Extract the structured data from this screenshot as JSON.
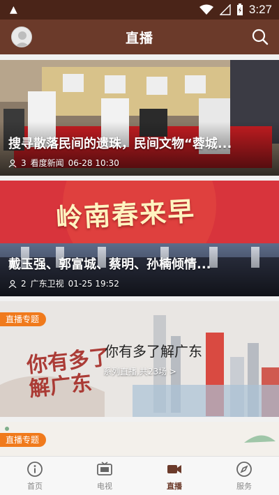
{
  "status_bar": {
    "time": "3:27"
  },
  "header": {
    "title": "直播"
  },
  "cards": [
    {
      "title": "搜寻散落民间的遗珠，民间文物“蓉城...",
      "viewers": "3",
      "source": "看度新闻",
      "datetime": "06-28 10:30"
    },
    {
      "title": "戴玉强、郭富城、蔡明、孙楠倾情...",
      "viewers": "2",
      "source": "广东卫视",
      "datetime": "01-25 19:52",
      "banner_text": "岭南春来早"
    }
  ],
  "topics": [
    {
      "tag": "直播专题",
      "title": "你有多了解广东",
      "subtitle": "系列直播,共23场 >",
      "art_text": "你有多了解广东"
    },
    {
      "tag": "直播专题"
    }
  ],
  "bottom_nav": [
    {
      "label": "首页",
      "icon": "info-icon",
      "active": false
    },
    {
      "label": "电视",
      "icon": "tv-icon",
      "active": false
    },
    {
      "label": "直播",
      "icon": "video-camera-icon",
      "active": true
    },
    {
      "label": "服务",
      "icon": "compass-icon",
      "active": false
    }
  ],
  "colors": {
    "header": "#6b3a2a",
    "status_bar": "#4a2418",
    "tag": "#f07a1c",
    "active_nav": "#6b3a2a"
  }
}
